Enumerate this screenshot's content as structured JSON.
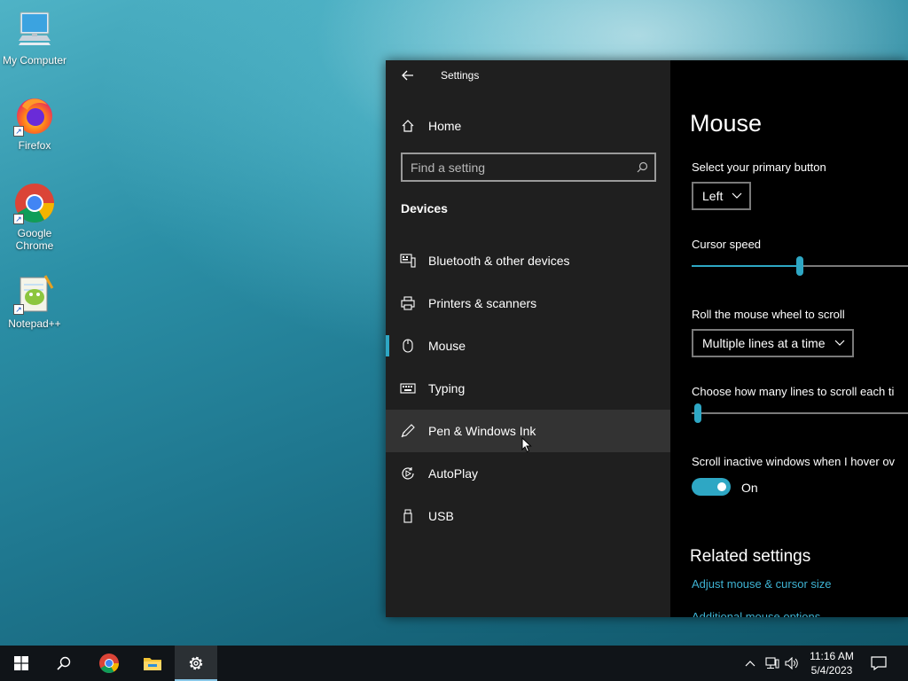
{
  "desktop": {
    "icons": [
      {
        "label": "My Computer"
      },
      {
        "label": "Firefox"
      },
      {
        "label": "Google Chrome"
      },
      {
        "label": "Notepad++"
      }
    ]
  },
  "settings": {
    "window_title": "Settings",
    "nav": {
      "home_label": "Home",
      "search_placeholder": "Find a setting",
      "section_label": "Devices",
      "items": [
        {
          "label": "Bluetooth & other devices",
          "icon": "bluetooth-devices-icon"
        },
        {
          "label": "Printers & scanners",
          "icon": "printer-icon"
        },
        {
          "label": "Mouse",
          "icon": "mouse-icon",
          "selected": true
        },
        {
          "label": "Typing",
          "icon": "keyboard-icon"
        },
        {
          "label": "Pen & Windows Ink",
          "icon": "pen-icon",
          "hovered": true
        },
        {
          "label": "AutoPlay",
          "icon": "autoplay-icon"
        },
        {
          "label": "USB",
          "icon": "usb-icon"
        }
      ]
    },
    "content": {
      "page_title": "Mouse",
      "primary_button_label": "Select your primary button",
      "primary_button_value": "Left",
      "cursor_speed_label": "Cursor speed",
      "cursor_speed_fraction": 0.5,
      "scroll_label": "Roll the mouse wheel to scroll",
      "scroll_value": "Multiple lines at a time",
      "lines_label": "Choose how many lines to scroll each ti",
      "lines_fraction": 0.03,
      "inactive_label": "Scroll inactive windows when I hover ov",
      "inactive_state": "On",
      "related_title": "Related settings",
      "related_links": [
        "Adjust mouse & cursor size",
        "Additional mouse options"
      ]
    }
  },
  "taskbar": {
    "time": "11:16 AM",
    "date": "5/4/2023"
  },
  "colors": {
    "accent": "#2ea7c4",
    "link": "#3eb3d3",
    "nav_bg": "#1f1f1f",
    "content_bg": "#000000"
  }
}
